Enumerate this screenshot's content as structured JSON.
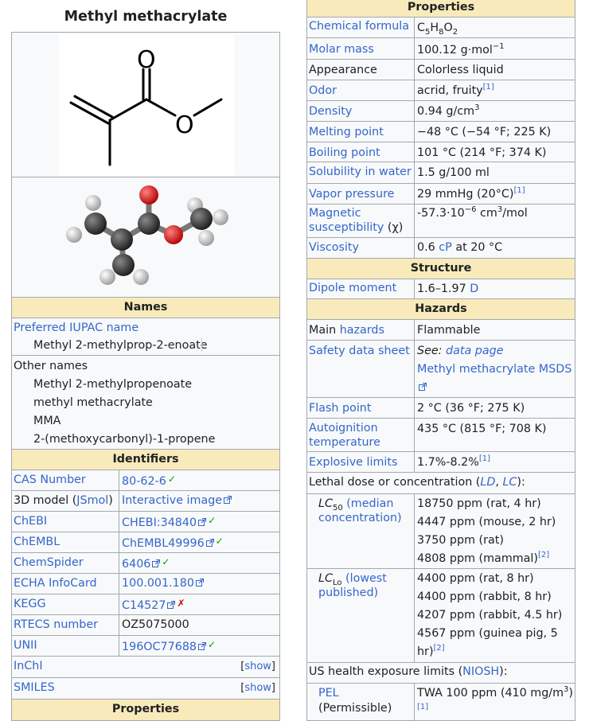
{
  "left": {
    "title": "Methyl methacrylate",
    "names_header": "Names",
    "iupac_label": "Preferred IUPAC name",
    "iupac_value": "Methyl 2-methylprop-2-enoate",
    "other_names_label": "Other names",
    "other_names": [
      "Methyl 2-methylpropenoate",
      "methyl methacrylate",
      "MMA",
      "2-(methoxycarbonyl)-1-propene"
    ],
    "identifiers_header": "Identifiers",
    "identifiers": [
      {
        "label": "CAS Number",
        "value": "80-62-6",
        "mark": "✓"
      },
      {
        "label_pre": "3D model (",
        "label_link": "JSmol",
        "label_post": ")",
        "value": "Interactive image",
        "mark": ""
      },
      {
        "label": "ChEBI",
        "value": "CHEBI:34840",
        "mark": "✓"
      },
      {
        "label": "ChEMBL",
        "value": "ChEMBL49996",
        "mark": "✓"
      },
      {
        "label": "ChemSpider",
        "value": "6406",
        "mark": "✓"
      },
      {
        "label": "ECHA InfoCard",
        "value": "100.001.180",
        "mark": ""
      },
      {
        "label": "KEGG",
        "value": "C14527",
        "mark": "✗"
      },
      {
        "label": "RTECS number",
        "value": "OZ5075000",
        "mark": ""
      },
      {
        "label": "UNII",
        "value": "196OC77688",
        "mark": "✓"
      }
    ],
    "inchi_label": "InChI",
    "smiles_label": "SMILES",
    "show_text": "show",
    "properties_header": "Properties"
  },
  "right": {
    "properties_header": "Properties",
    "formula_label": "Chemical formula",
    "formula": {
      "c": "C",
      "c_n": "5",
      "h": "H",
      "h_n": "8",
      "o": "O",
      "o_n": "2"
    },
    "molar_label": "Molar mass",
    "molar_value": "100.12 g·mol",
    "molar_sup": "−1",
    "appearance_label": "Appearance",
    "appearance_value": "Colorless liquid",
    "odor_label": "Odor",
    "odor_value": "acrid, fruity",
    "ref1": "[1]",
    "density_label": "Density",
    "density_value": "0.94 g/cm",
    "density_sup": "3",
    "melting_label": "Melting point",
    "melting_value": "−48 °C (−54 °F; 225 K)",
    "boiling_label": "Boiling point",
    "boiling_value": "101 °C (214 °F; 374 K)",
    "solubility_label": "Solubility in water",
    "solubility_value": "1.5 g/100 ml",
    "vapor_label": "Vapor pressure",
    "vapor_value": "29 mmHg (20°C)",
    "magnetic_label": "Magnetic susceptibility",
    "magnetic_chi": "(χ)",
    "magnetic_value_pre": "-57.3·10",
    "magnetic_sup1": "−6",
    "magnetic_value_mid": " cm",
    "magnetic_sup2": "3",
    "magnetic_value_post": "/mol",
    "viscosity_label": "Viscosity",
    "viscosity_value_pre": "0.6 ",
    "viscosity_cp": "cP",
    "viscosity_value_post": " at 20 °C",
    "structure_header": "Structure",
    "dipole_label": "Dipole moment",
    "dipole_value": "1.6–1.97 ",
    "dipole_unit": "D",
    "hazards_header": "Hazards",
    "main_hazards_pre": "Main ",
    "main_hazards_link": "hazards",
    "main_hazards_value": "Flammable",
    "sds_label": "Safety data sheet",
    "sds_see": "See: ",
    "sds_page": "data page",
    "sds_msds": "Methyl methacrylate MSDS",
    "flash_label": "Flash point",
    "flash_value": "2 °C (36 °F; 275 K)",
    "autoign_label": "Autoignition temperature",
    "autoign_value": "435 °C (815 °F; 708 K)",
    "explosive_label": "Explosive limits",
    "explosive_value": "1.7%-8.2%",
    "lethal_header_pre": "Lethal dose or concentration (",
    "lethal_ld": "LD",
    "lethal_sep": ", ",
    "lethal_lc": "LC",
    "lethal_header_post": "):",
    "lc50_label_lc": "LC",
    "lc50_sub": "50",
    "lc50_link": "(median concentration)",
    "lc50_values": [
      "18750 ppm (rat, 4 hr)",
      "4447 ppm (mouse, 2 hr)",
      "3750 ppm (rat)",
      "4808 ppm (mammal)"
    ],
    "ref2": "[2]",
    "lclo_label_lc": "LC",
    "lclo_sub": "Lo",
    "lclo_link": "(lowest published)",
    "lclo_values": [
      "4400 ppm (rat, 8 hr)",
      "4400 ppm (rabbit, 8 hr)",
      "4207 ppm (rabbit, 4.5 hr)",
      "4567 ppm (guinea pig, 5 hr)"
    ],
    "us_header_pre": "US health exposure limits (",
    "us_link": "NIOSH",
    "us_header_post": "):",
    "pel_link": "PEL",
    "pel_sub": "(Permissible)",
    "pel_value_pre": "TWA 100 ppm (410 mg/m",
    "pel_sup": "3",
    "pel_value_post": ")"
  },
  "colors": {
    "header_bg": "#f8eaba",
    "link": "#3366cc",
    "cell_bg": "#f8f9fa",
    "border": "#a2a9b1",
    "tick": "#00a000",
    "cross": "#d00000"
  },
  "icons": {
    "external_link": "external-link-icon",
    "check": "check-icon",
    "cross": "cross-icon"
  }
}
